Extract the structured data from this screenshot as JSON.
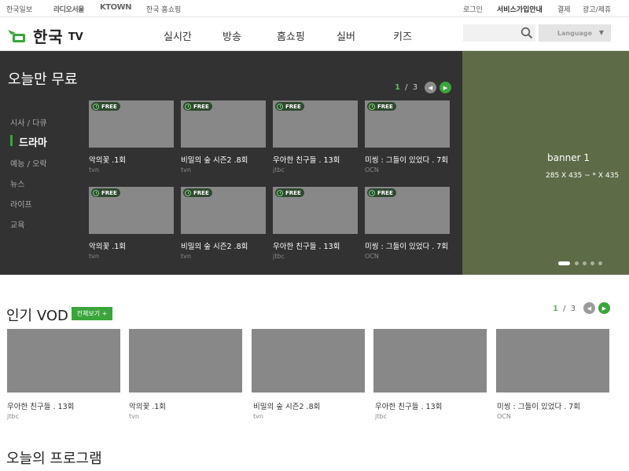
{
  "topbar": {
    "partners": [
      "한국일보",
      "라디오서울",
      "KTOWN",
      "한국 홈쇼핑"
    ],
    "links": [
      "로그인",
      "서비스가입안내",
      "결제",
      "광고/제휴"
    ]
  },
  "header": {
    "logo_text": "한국",
    "logo_tv": "TV",
    "nav": [
      "실시간",
      "방송",
      "홈쇼핑",
      "실버",
      "키즈"
    ],
    "search_placeholder": "",
    "language_label": "Language",
    "language_arrow": "▼"
  },
  "free": {
    "title": "오늘만 무료",
    "pager": {
      "current": "1",
      "sep": "/",
      "total": "3"
    },
    "categories": [
      "시사 / 다큐",
      "드라마",
      "예능 / 오락",
      "뉴스",
      "라이프",
      "교육"
    ],
    "active_category": 1,
    "badge": "FREE",
    "items": [
      {
        "title": "악의꽃 .1회",
        "channel": "tvn"
      },
      {
        "title": "비밀의 숲 시즌2 .8회",
        "channel": "tvn"
      },
      {
        "title": "우아한 친구들 . 13회",
        "channel": "jtbc"
      },
      {
        "title": "미씽 : 그들이 있었다 . 7회",
        "channel": "OCN"
      },
      {
        "title": "악의꽃 .1회",
        "channel": "tvn"
      },
      {
        "title": "비밀의 숲 시즌2 .8회",
        "channel": "tvn"
      },
      {
        "title": "우아한 친구들 . 13회",
        "channel": "jtbc"
      },
      {
        "title": "미씽 : 그들이 있었다 . 7회",
        "channel": "OCN"
      }
    ]
  },
  "banner": {
    "title": "banner 1",
    "size_text": "285 X 435 ~ * X 435",
    "dots": 5,
    "active_dot": 0,
    "bg_color": "#5e6b47"
  },
  "vod": {
    "title": "인기 VOD",
    "all_button": "전체보기 +",
    "pager": {
      "current": "1",
      "sep": "/",
      "total": "3"
    },
    "items": [
      {
        "title": "우아한 친구들 . 13회",
        "channel": "jtbc"
      },
      {
        "title": "악의꽃 .1회",
        "channel": "tvn"
      },
      {
        "title": "비밀의 숲 시즌2 .8회",
        "channel": "tvn"
      },
      {
        "title": "우아한 친구들 . 13회",
        "channel": "jtbc"
      },
      {
        "title": "미씽 : 그들이 있었다 . 7회",
        "channel": "OCN"
      }
    ]
  },
  "program": {
    "title": "오늘의 프로그램"
  },
  "colors": {
    "accent": "#3aa53a",
    "dark_bg": "#323232",
    "thumb": "#888888"
  }
}
